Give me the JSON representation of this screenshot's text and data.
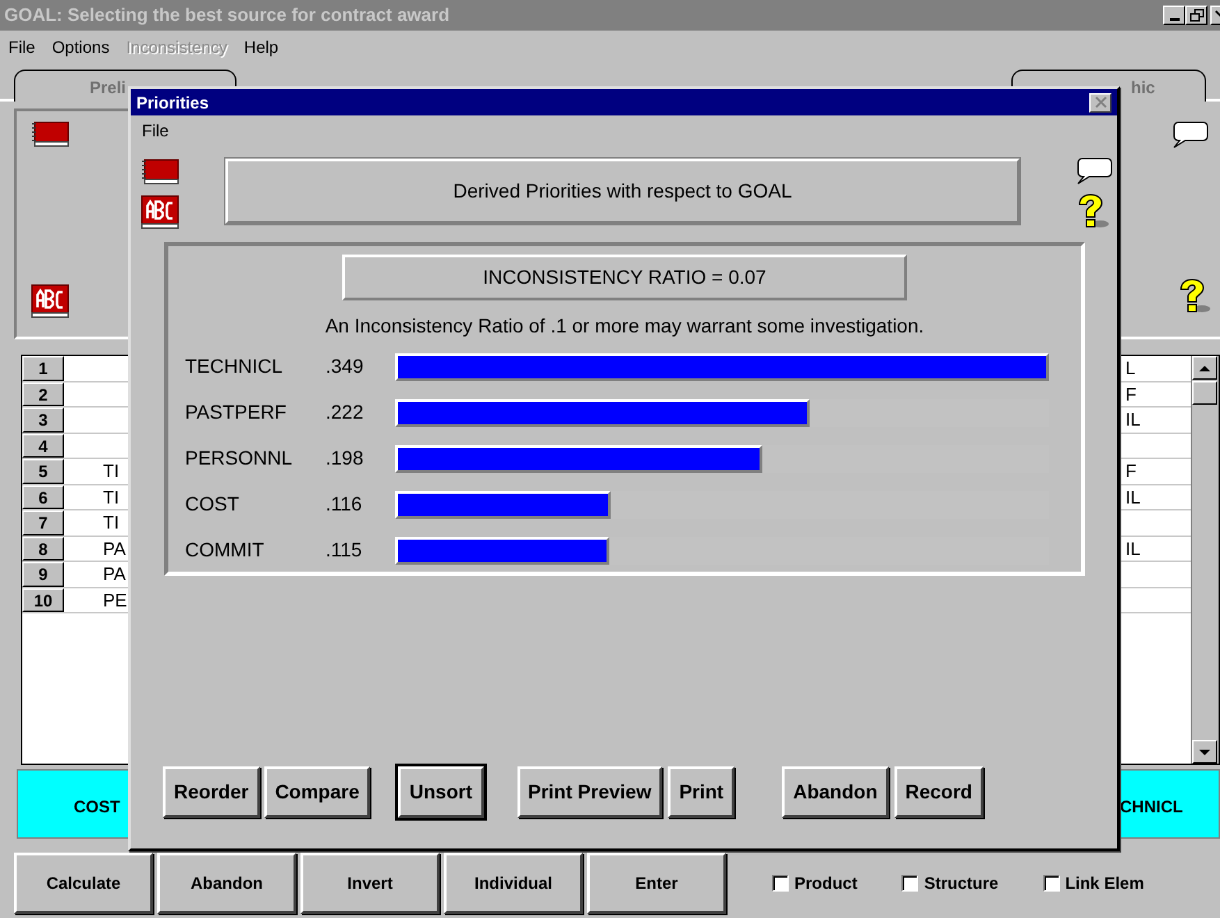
{
  "window": {
    "title": "GOAL: Selecting the best source for contract award"
  },
  "menu": [
    {
      "label": "File",
      "disabled": false
    },
    {
      "label": "Options",
      "disabled": false
    },
    {
      "label": "Inconsistency",
      "disabled": true
    },
    {
      "label": "Help",
      "disabled": false
    }
  ],
  "tabs": [
    {
      "label": "Preli"
    },
    {
      "label": "hic"
    }
  ],
  "table": {
    "rows": [
      {
        "number": "1",
        "column_3": "L"
      },
      {
        "number": "2",
        "column_3": "F"
      },
      {
        "number": "3",
        "column_3": "IL"
      },
      {
        "number": "4"
      },
      {
        "number": "5",
        "column_2": "TI",
        "column_3": "F"
      },
      {
        "number": "6",
        "column_2": "TI",
        "column_3": "IL"
      },
      {
        "number": "7",
        "column_2": "TI"
      },
      {
        "number": "8",
        "column_2": "PA",
        "column_3": "IL"
      },
      {
        "number": "9",
        "column_2": "PA"
      },
      {
        "number": "10",
        "column_2": "PE"
      }
    ]
  },
  "compare_bar": {
    "left": "COST",
    "right": "CHNICL"
  },
  "buttons": [
    "Calculate",
    "Abandon",
    "Invert",
    "Individual",
    "Enter"
  ],
  "checkboxes": [
    {
      "label": "Product",
      "checked": false
    },
    {
      "label": "Structure",
      "checked": false
    },
    {
      "label": "Link Elem",
      "checked": false
    }
  ],
  "dialog": {
    "title": "Priorities",
    "menu": [
      "File"
    ],
    "heading": "Derived Priorities with respect to GOAL",
    "ratio": "INCONSISTENCY RATIO = 0.07",
    "note": "An Inconsistency Ratio of .1 or more may warrant some investigation.",
    "priorities": [
      {
        "name": "TECHNICL",
        "value": ".349",
        "level": 1.0
      },
      {
        "name": "PASTPERF",
        "value": ".222",
        "level": 0.635
      },
      {
        "name": "PERSONNL",
        "value": ".198",
        "level": 0.562
      },
      {
        "name": "COST",
        "value": ".116",
        "level": 0.33
      },
      {
        "name": "COMMIT",
        "value": ".115",
        "level": 0.327
      }
    ],
    "buttons": [
      {
        "label": "Reorder",
        "default": false
      },
      {
        "label": "Compare",
        "default": false
      },
      {
        "label": "Unsort",
        "default": true
      },
      {
        "label": "Print Preview",
        "default": false
      },
      {
        "label": "Print",
        "default": false
      },
      {
        "label": "Abandon",
        "default": false
      },
      {
        "label": "Record",
        "default": false
      }
    ]
  }
}
